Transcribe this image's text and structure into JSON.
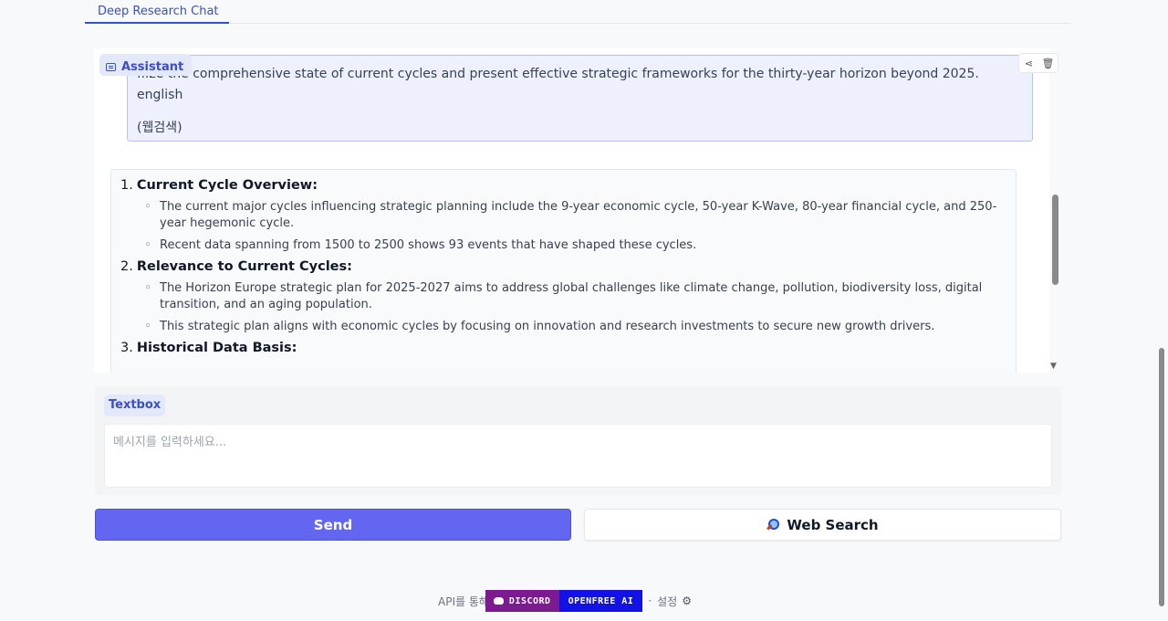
{
  "tabs": [
    {
      "label": "Deep Research Chat"
    }
  ],
  "chat": {
    "assistant_badge": "Assistant",
    "user_message": {
      "line1": "...ze the comprehensive state of current cycles and present effective strategic frameworks for the thirty-year horizon beyond 2025.",
      "line2": "english",
      "line3": "(웹검색)"
    },
    "actions": {
      "share_icon": "share-icon",
      "delete_icon": "trash-icon"
    },
    "answer": {
      "sections": [
        {
          "num": "1.",
          "title": "Current Cycle Overview:",
          "bullets": [
            "The current major cycles influencing strategic planning include the 9-year economic cycle, 50-year K-Wave, 80-year financial cycle, and 250-year hegemonic cycle.",
            "Recent data spanning from 1500 to 2500 shows 93 events that have shaped these cycles."
          ]
        },
        {
          "num": "2.",
          "title": "Relevance to Current Cycles:",
          "bullets": [
            "The Horizon Europe strategic plan for 2025-2027 aims to address global challenges like climate change, pollution, biodiversity loss, digital transition, and an aging population.",
            "This strategic plan aligns with economic cycles by focusing on innovation and research investments to secure new growth drivers."
          ]
        },
        {
          "num": "3.",
          "title": "Historical Data Basis:",
          "bullets": []
        }
      ]
    }
  },
  "input": {
    "label": "Textbox",
    "placeholder": "메시지를 입력하세요...",
    "value": ""
  },
  "buttons": {
    "send": "Send",
    "web_search": "Web Search"
  },
  "footer": {
    "api_text": "API를 통해",
    "discord": "DISCORD",
    "openfree": "OPENFREE AI",
    "separator": "·",
    "settings": "설정"
  },
  "colors": {
    "accent": "#3b4fc4",
    "send_button": "#6366f1",
    "discord_badge": "#7c1a8f",
    "openfree_badge": "#1212e8"
  }
}
